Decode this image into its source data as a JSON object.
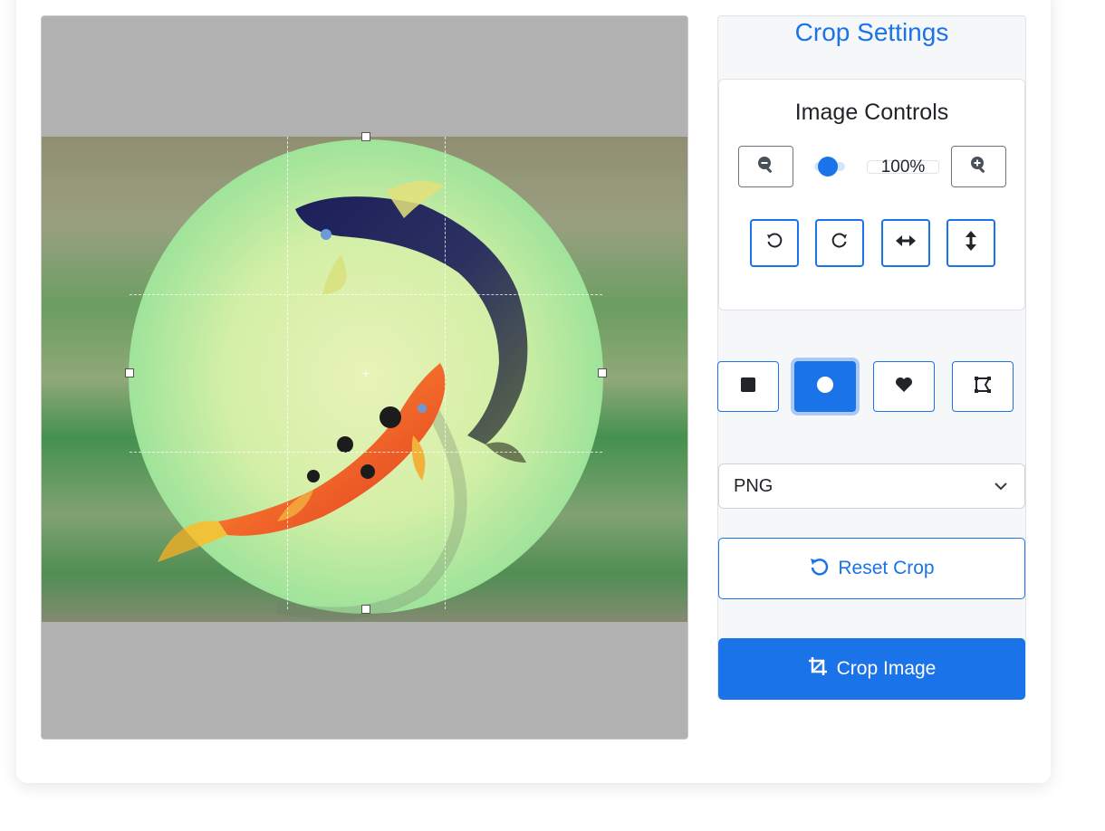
{
  "settings": {
    "title": "Crop Settings"
  },
  "controls": {
    "title": "Image Controls",
    "zoom_level": "100%",
    "zoom_fraction": 0.33,
    "zoom_out_icon": "zoom-out-icon",
    "zoom_in_icon": "zoom-in-icon",
    "tools": [
      {
        "name": "rotate-left",
        "icon": "rotate-left-icon"
      },
      {
        "name": "rotate-right",
        "icon": "rotate-right-icon"
      },
      {
        "name": "flip-horizontal",
        "icon": "arrows-horizontal-icon"
      },
      {
        "name": "flip-vertical",
        "icon": "arrows-vertical-icon"
      }
    ]
  },
  "shapes": [
    {
      "name": "square",
      "icon": "square-icon",
      "active": false
    },
    {
      "name": "circle",
      "icon": "circle-icon",
      "active": true
    },
    {
      "name": "heart",
      "icon": "heart-icon",
      "active": false
    },
    {
      "name": "custom",
      "icon": "polygon-icon",
      "active": false
    }
  ],
  "format": {
    "selected": "PNG"
  },
  "actions": {
    "reset_label": "Reset Crop",
    "crop_label": "Crop Image"
  },
  "colors": {
    "accent": "#1a73e8",
    "canvas_bg": "#b1b1b1",
    "panel_bg": "#f5f7f9"
  }
}
